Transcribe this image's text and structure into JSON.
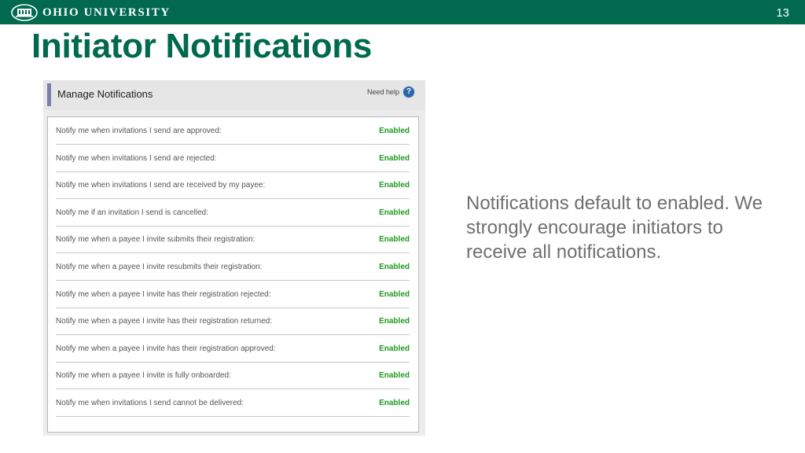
{
  "header": {
    "org_name": "OHIO UNIVERSITY",
    "slide_number": "13",
    "logo_icon": "university-seal-icon"
  },
  "page_title": "Initiator Notifications",
  "panel": {
    "title": "Manage Notifications",
    "help_label": "Need help",
    "help_icon": "question-circle-icon",
    "rows": [
      {
        "label": "Notify me when invitations I send are approved:",
        "status": "Enabled"
      },
      {
        "label": "Notify me when invitations I send are rejected:",
        "status": "Enabled"
      },
      {
        "label": "Notify me when invitations I send are received by my payee:",
        "status": "Enabled"
      },
      {
        "label": "Notify me if an invitation I send is cancelled:",
        "status": "Enabled"
      },
      {
        "label": "Notify me when a payee I invite submits their registration:",
        "status": "Enabled"
      },
      {
        "label": "Notify me when a payee I invite resubmits their registration:",
        "status": "Enabled"
      },
      {
        "label": "Notify me when a payee I invite has their registration rejected:",
        "status": "Enabled"
      },
      {
        "label": "Notify me when a payee I invite has their registration returned:",
        "status": "Enabled"
      },
      {
        "label": "Notify me when a payee I invite has their registration approved:",
        "status": "Enabled"
      },
      {
        "label": "Notify me when a payee I invite is fully onboarded:",
        "status": "Enabled"
      },
      {
        "label": "Notify me when invitations I send cannot be delivered:",
        "status": "Enabled"
      }
    ]
  },
  "side_note": "Notifications default to enabled. We strongly encourage initiators to receive all notifications.",
  "colors": {
    "brand_green": "#00694e",
    "enabled_green": "#1e9a1e",
    "accent_bar": "#7d7eae",
    "help_blue": "#2e67a8"
  }
}
